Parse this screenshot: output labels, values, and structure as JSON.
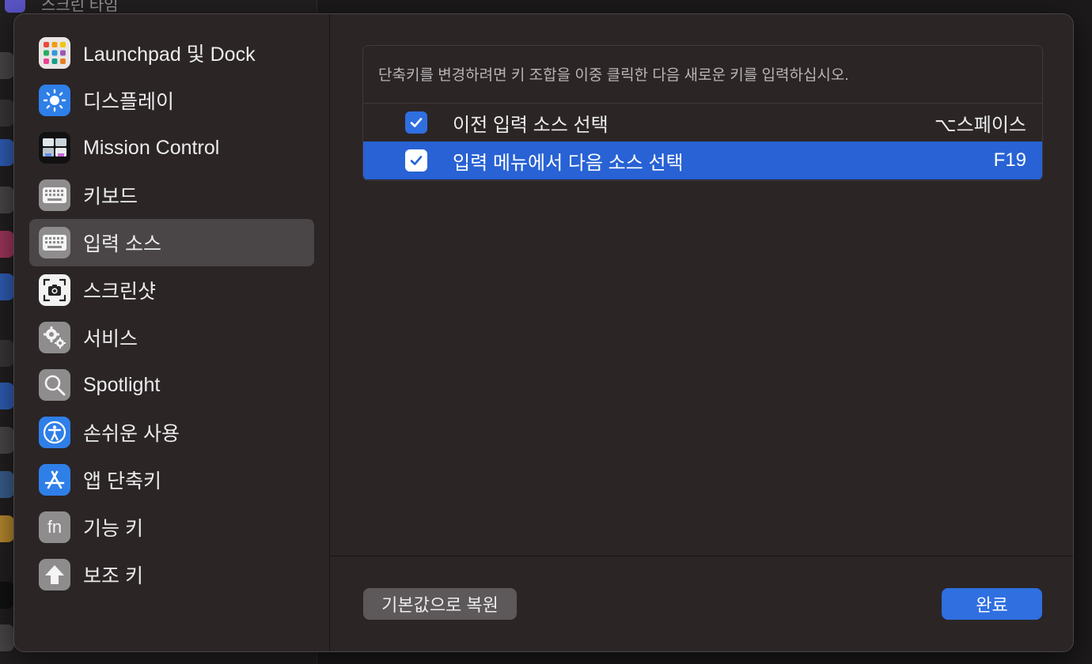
{
  "background": {
    "partial_title": "스크린 타임"
  },
  "sidebar": {
    "items": [
      {
        "label": "Launchpad 및 Dock",
        "icon": "launchpad-icon"
      },
      {
        "label": "디스플레이",
        "icon": "display-brightness-icon"
      },
      {
        "label": "Mission Control",
        "icon": "mission-control-icon"
      },
      {
        "label": "키보드",
        "icon": "keyboard-icon"
      },
      {
        "label": "입력 소스",
        "icon": "keyboard-icon",
        "selected": true
      },
      {
        "label": "스크린샷",
        "icon": "screenshot-camera-icon"
      },
      {
        "label": "서비스",
        "icon": "gears-icon"
      },
      {
        "label": "Spotlight",
        "icon": "magnifier-icon"
      },
      {
        "label": "손쉬운 사용",
        "icon": "accessibility-icon"
      },
      {
        "label": "앱 단축키",
        "icon": "app-store-icon"
      },
      {
        "label": "기능 키",
        "icon": "fn-key-icon"
      },
      {
        "label": "보조 키",
        "icon": "up-arrow-icon"
      }
    ]
  },
  "main": {
    "hint": "단축키를 변경하려면 키 조합을 이중 클릭한 다음 새로운 키를 입력하십시오.",
    "shortcuts": [
      {
        "label": "이전 입력 소스 선택",
        "key": "⌥스페이스",
        "checked": true,
        "selected": false
      },
      {
        "label": "입력 메뉴에서 다음 소스 선택",
        "key": "F19",
        "checked": true,
        "selected": true
      }
    ]
  },
  "footer": {
    "restore_label": "기본값으로 복원",
    "done_label": "완료"
  },
  "colors": {
    "accent": "#2f6fe0",
    "selected_row": "#2862d4",
    "sheet_bg": "#2b2526",
    "sidebar_selected": "#4a4546"
  }
}
